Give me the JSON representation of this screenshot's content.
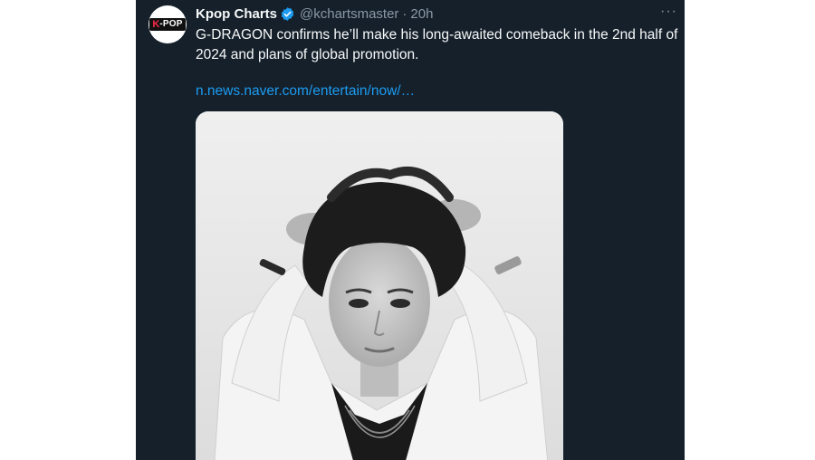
{
  "tweet": {
    "author_name": "Kpop Charts",
    "handle": "@kchartsmaster",
    "separator": "·",
    "time": "20h",
    "more_glyph": "···",
    "avatar_logo_k": "K",
    "avatar_logo_rest": "-POP",
    "text": "G-DRAGON confirms he’ll make his long-awaited comeback in the 2nd half of 2024 and plans of global promotion.",
    "link_text": "n.news.naver.com/entertain/now/…",
    "icons": {
      "verified": "verified-badge-icon",
      "more": "more-options-icon"
    },
    "colors": {
      "background": "#15202b",
      "text": "#f7f9f9",
      "secondary": "#8b98a5",
      "link": "#1d9bf0"
    }
  }
}
